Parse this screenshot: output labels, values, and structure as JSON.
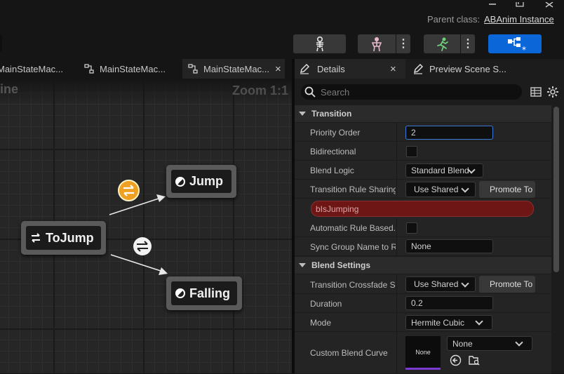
{
  "header": {
    "parent_class_label": "Parent class:",
    "parent_class_value": "ABAnim Instance"
  },
  "toolbar": {
    "icons": [
      "skeleton-icon",
      "skeletal-mesh-icon",
      "animation-running-icon",
      "blueprint-graph-icon"
    ],
    "accent": "#0b67d8"
  },
  "tabs": [
    {
      "label": "MainStateMachine",
      "display": "MainStateMac..."
    },
    {
      "label": "MainStateMachine",
      "display": "MainStateMac..."
    },
    {
      "label": "MainStateMachine",
      "display": "MainStateMac...",
      "close": "×"
    }
  ],
  "graph": {
    "title": "ine",
    "zoom": "Zoom 1:1",
    "nodes": {
      "tojump": "ToJump",
      "jump": "Jump",
      "falling": "Falling"
    },
    "transition_color_active": "#f0a020"
  },
  "details": {
    "tabs": [
      {
        "label": "Details",
        "close": "×"
      },
      {
        "label": "Preview Scene S..."
      }
    ],
    "search_placeholder": "Search",
    "categories": {
      "transition": "Transition",
      "blend_settings": "Blend Settings"
    },
    "rows": {
      "priority_order": {
        "label": "Priority Order",
        "value": "2"
      },
      "bidirectional": {
        "label": "Bidirectional",
        "checked": false
      },
      "blend_logic": {
        "label": "Blend Logic",
        "value": "Standard Blend"
      },
      "transition_rule_sharing": {
        "label": "Transition Rule Sharing",
        "value": "Use Shared",
        "button": "Promote To"
      },
      "rule_binding": {
        "value": "bIsJumping",
        "color": "#6e1616"
      },
      "automatic_rule": {
        "label": "Automatic Rule Based...",
        "checked": false
      },
      "sync_group": {
        "label": "Sync Group Name to R...",
        "value": "None"
      },
      "transition_crossfade": {
        "label": "Transition Crossfade Sha",
        "value": "Use Shared",
        "button": "Promote To"
      },
      "duration": {
        "label": "Duration",
        "value": "0.2"
      },
      "mode": {
        "label": "Mode",
        "value": "Hermite Cubic"
      },
      "custom_blend_curve": {
        "label": "Custom Blend Curve",
        "thumb": "None",
        "value": "None"
      }
    }
  }
}
